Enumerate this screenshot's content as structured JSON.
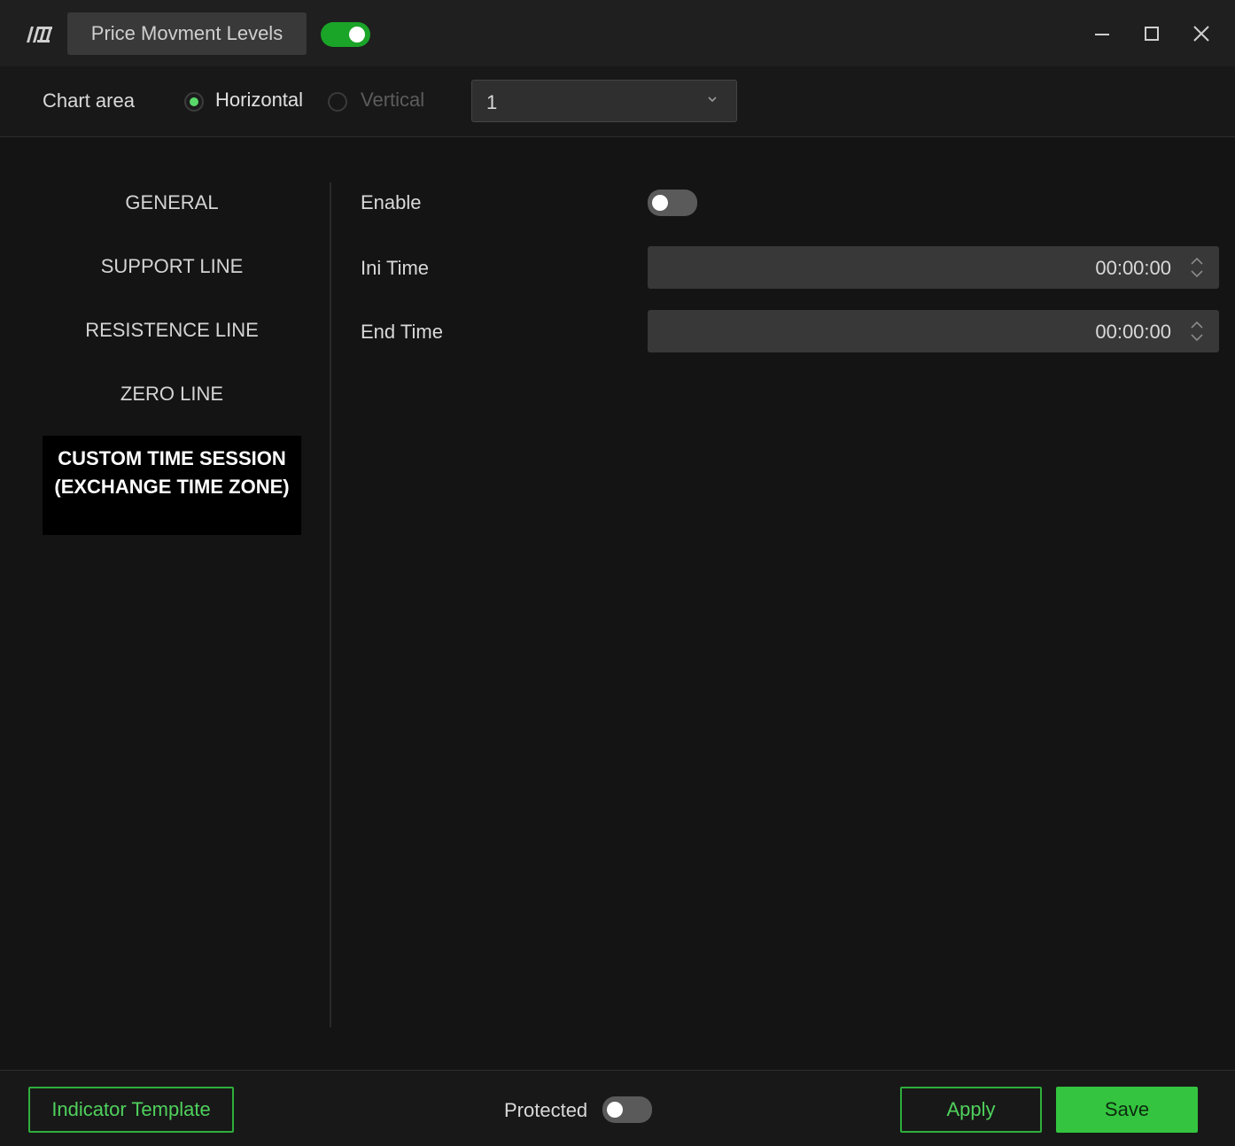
{
  "window": {
    "title": "Price Movment Levels",
    "indicator_enabled": true
  },
  "toolbar": {
    "chart_area_label": "Chart area",
    "orientation_options": [
      {
        "label": "Horizontal",
        "selected": true
      },
      {
        "label": "Vertical",
        "selected": false
      }
    ],
    "chart_area_value": "1"
  },
  "sidebar": {
    "items": [
      {
        "label": "GENERAL",
        "active": false
      },
      {
        "label": "SUPPORT LINE",
        "active": false
      },
      {
        "label": "RESISTENCE LINE",
        "active": false
      },
      {
        "label": "ZERO LINE",
        "active": false
      },
      {
        "label": "CUSTOM TIME SESSION (EXCHANGE TIME ZONE)",
        "active": true
      }
    ]
  },
  "settings": {
    "enable_label": "Enable",
    "enable_value": false,
    "ini_time_label": "Ini Time",
    "ini_time_value": "00:00:00",
    "end_time_label": "End Time",
    "end_time_value": "00:00:00"
  },
  "footer": {
    "template_button": "Indicator Template",
    "protected_label": "Protected",
    "protected_value": false,
    "apply_button": "Apply",
    "save_button": "Save"
  },
  "colors": {
    "accent_green": "#34c43f",
    "toggle_on": "#1aa428",
    "background": "#141414",
    "title_bar": "#1f1f1f"
  },
  "icons": [
    "app-logo-icon",
    "minimize-icon",
    "maximize-icon",
    "close-icon",
    "chevron-down-icon",
    "spinner-arrows-icon"
  ]
}
